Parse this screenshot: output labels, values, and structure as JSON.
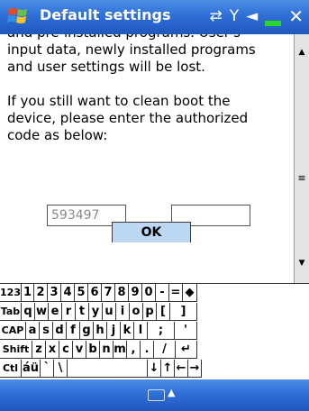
{
  "title_bar": {
    "title": "Default settings",
    "status_icons": [
      "sync-icon",
      "signal-off-icon",
      "volume-icon",
      "battery-icon",
      "close-icon"
    ]
  },
  "message": {
    "partial_line": "and pre-installed programs. User's",
    "paragraph1_line1": "input data, newly installed programs",
    "paragraph1_line2": "and user settings will be lost.",
    "paragraph2_line1": "If you still want to clean boot the",
    "paragraph2_line2": "device, please enter the authorized",
    "paragraph2_line3": "code as below:"
  },
  "form": {
    "code_display": "593497",
    "code_entry": "",
    "ok_label": "OK"
  },
  "keyboard": {
    "rows": [
      [
        "123",
        "1",
        "2",
        "3",
        "4",
        "5",
        "6",
        "7",
        "8",
        "9",
        "0",
        "-",
        "=",
        "◆"
      ],
      [
        "Tab",
        "q",
        "w",
        "e",
        "r",
        "t",
        "y",
        "u",
        "i",
        "o",
        "p",
        "[",
        "]"
      ],
      [
        "CAP",
        "a",
        "s",
        "d",
        "f",
        "g",
        "h",
        "j",
        "k",
        "l",
        ";",
        "'"
      ],
      [
        "Shift",
        "z",
        "x",
        "c",
        "v",
        "b",
        "n",
        "m",
        ",",
        ".",
        "/",
        "↵"
      ],
      [
        "Ctl",
        "áü",
        "`",
        "\\",
        "",
        "↓",
        "↑",
        "←",
        "→"
      ]
    ]
  },
  "bottom_bar": {
    "sip_icon": "keyboard-icon",
    "sip_arrow": "▲"
  }
}
